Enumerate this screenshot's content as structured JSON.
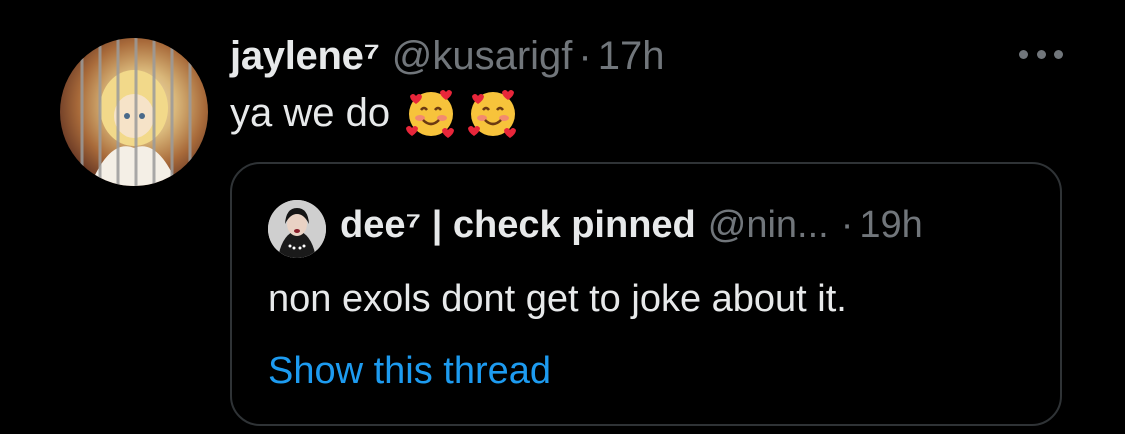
{
  "tweet": {
    "display_name": "jaylene⁷",
    "handle": "@kusarigf",
    "separator": "·",
    "time": "17h",
    "text": "ya we do",
    "emojis": [
      "smiling-face-with-hearts",
      "smiling-face-with-hearts"
    ],
    "more_icon": "more-horizontal-icon"
  },
  "quote": {
    "display_name": "dee⁷ | check pinned",
    "handle": "@nin...",
    "separator": "·",
    "time": "19h",
    "text": "non exols dont get to joke about it.",
    "link": "Show this thread"
  },
  "colors": {
    "background": "#000000",
    "primary_text": "#e7e9ea",
    "secondary_text": "#71767b",
    "link": "#1d9bf0",
    "border": "#2f3336"
  }
}
